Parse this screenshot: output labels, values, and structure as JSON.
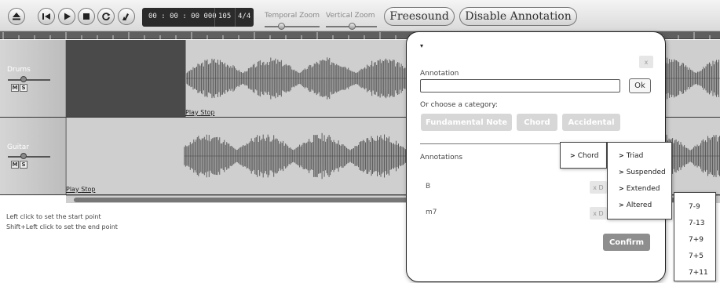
{
  "toolbar": {
    "time": "00 : 00 : 00 000",
    "bpm": "105",
    "signature": "4/4",
    "temporal_zoom_label": "Temporal Zoom",
    "vertical_zoom_label": "Vertical Zoom",
    "temporal_zoom_level": 0.3,
    "vertical_zoom_level": 0.5,
    "freesound_label": "Freesound",
    "disable_annotation_label": "Disable Annotation",
    "icons": [
      "eject-icon",
      "rewind-icon",
      "play-icon",
      "stop-icon",
      "loop-icon",
      "clear-icon"
    ]
  },
  "tracks": [
    {
      "name": "Drums",
      "mute_label": "M",
      "solo_label": "S",
      "play_label": "Play",
      "stop_label": "Stop"
    },
    {
      "name": "Guitar",
      "mute_label": "M",
      "solo_label": "S",
      "play_label": "Play",
      "stop_label": "Stop"
    }
  ],
  "hints": {
    "start": "Left click to set the start point",
    "end": "Shift+Left click to set the end point"
  },
  "popup": {
    "marker": "▾",
    "close_label": "x",
    "annotation_label": "Annotation",
    "annotation_value": "",
    "ok_label": "Ok",
    "category_prompt": "Or choose a category:",
    "categories": [
      "Fundamental Note",
      "Chord",
      "Accidental"
    ],
    "annotations_heading": "Annotations",
    "annotations": [
      {
        "text": "B",
        "delete_label": "x D"
      },
      {
        "text": "m7",
        "delete_label": "x D"
      }
    ],
    "confirm_label": "Confirm"
  },
  "menus": {
    "level1": [
      "Chord"
    ],
    "level2": [
      "Triad",
      "Suspended",
      "Extended",
      "Altered"
    ],
    "level3": [
      "7-9",
      "7-13",
      "7+9",
      "7+5",
      "7+11"
    ]
  },
  "colors": {
    "toolbar_bg": "#dadada",
    "track_bg": "#4a4a4a",
    "waveform": "#5c5c5c",
    "clip_bg": "#cfcfcf",
    "category_button": "#d7d7d7",
    "confirm_button": "#8e8e8e"
  }
}
